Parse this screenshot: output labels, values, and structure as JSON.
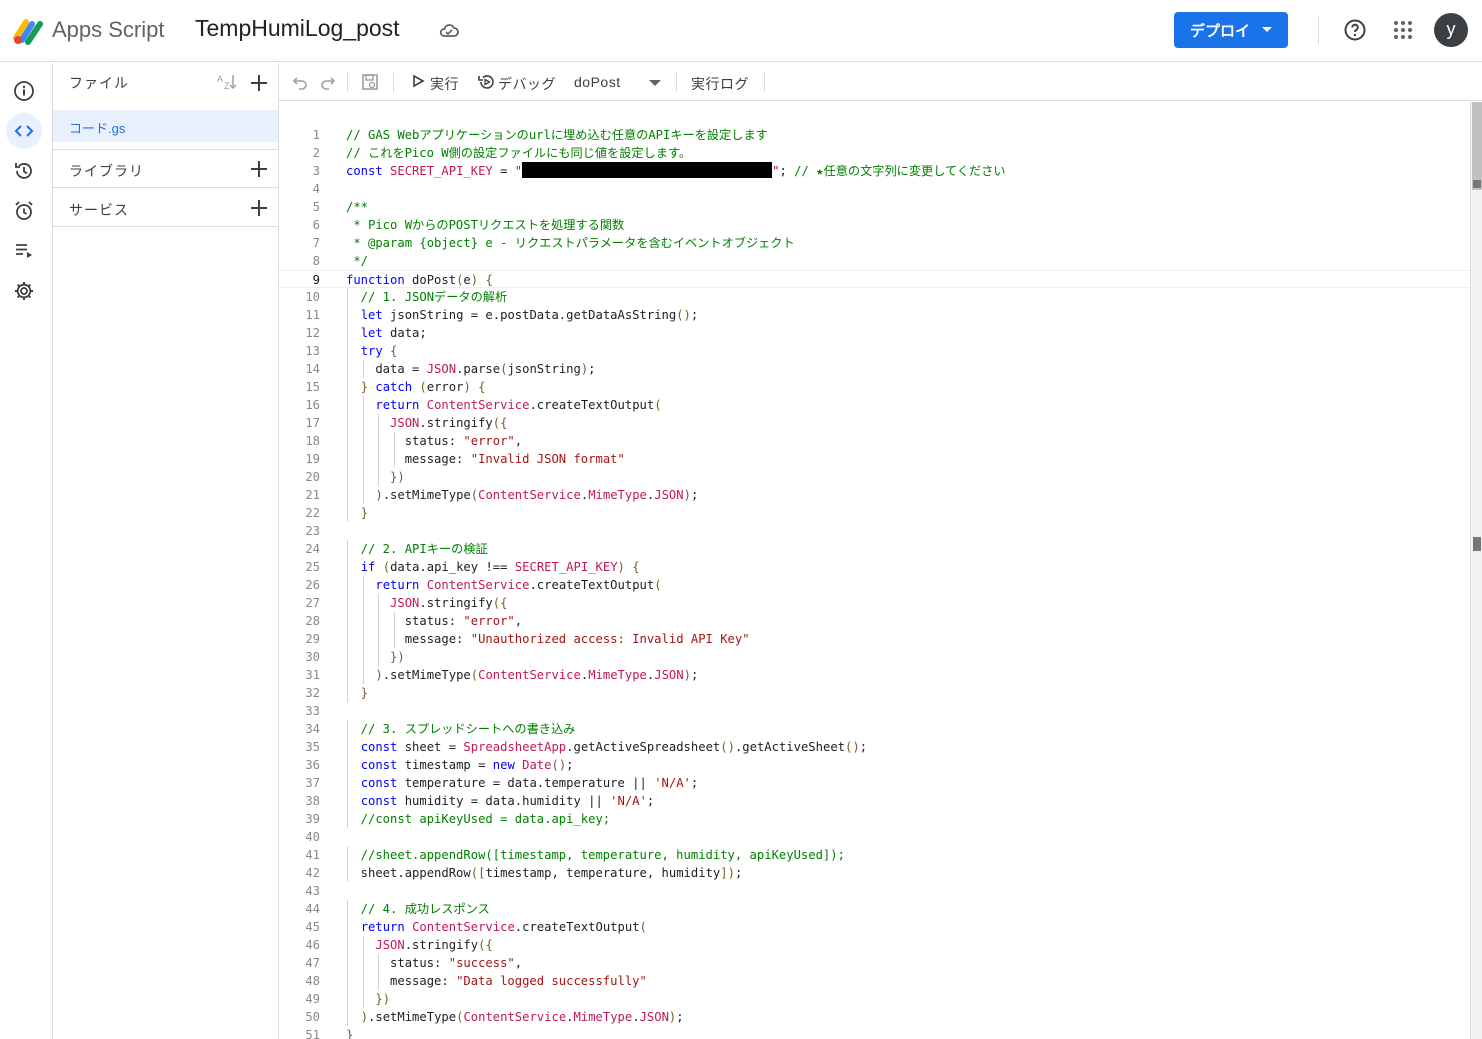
{
  "header": {
    "app_name": "Apps Script",
    "project_title": "TempHumiLog_post",
    "deploy_label": "デプロイ",
    "avatar_initial": "y",
    "accent_color": "#1a73e8"
  },
  "rail": {
    "items": [
      "info-icon",
      "code-icon",
      "history-icon",
      "alarm-icon",
      "executions-icon",
      "settings-icon"
    ],
    "active": "code-icon"
  },
  "files_panel": {
    "title": "ファイル",
    "files": [
      "コード.gs"
    ],
    "libraries_label": "ライブラリ",
    "services_label": "サービス"
  },
  "toolbar": {
    "run_label": "実行",
    "debug_label": "デバッグ",
    "function_name": "doPost",
    "log_label": "実行ログ"
  },
  "editor": {
    "current_line": 9,
    "line_numbers": [
      "1",
      "2",
      "3",
      "4",
      "5",
      "6",
      "7",
      "8",
      "9",
      "10",
      "11",
      "12",
      "13",
      "14",
      "15",
      "16",
      "17",
      "18",
      "19",
      "20",
      "21",
      "22",
      "23",
      "24",
      "25",
      "26",
      "27",
      "28",
      "29",
      "30",
      "31",
      "32",
      "33",
      "34",
      "35",
      "36",
      "37",
      "38",
      "39",
      "40",
      "41",
      "42",
      "43",
      "44",
      "45",
      "46",
      "47",
      "48",
      "49",
      "50",
      "51"
    ],
    "lines": [
      "// GAS Webアプリケーションのurlに埋め込む任意のAPIキーを設定します",
      "// これをPico W側の設定ファイルにも同じ値を設定します。",
      "const SECRET_API_KEY = \"[REDACTED]\"; // ★任意の文字列に変更してください",
      "",
      "/**",
      " * Pico WからのPOSTリクエストを処理する関数",
      " * @param {object} e - リクエストパラメータを含むイベントオブジェクト",
      " */",
      "function doPost(e) {",
      "  // 1. JSONデータの解析",
      "  let jsonString = e.postData.getDataAsString();",
      "  let data;",
      "  try {",
      "    data = JSON.parse(jsonString);",
      "  } catch (error) {",
      "    return ContentService.createTextOutput(",
      "      JSON.stringify({",
      "        status: \"error\",",
      "        message: \"Invalid JSON format\"",
      "      })",
      "    ).setMimeType(ContentService.MimeType.JSON);",
      "  }",
      "",
      "  // 2. APIキーの検証",
      "  if (data.api_key !== SECRET_API_KEY) {",
      "    return ContentService.createTextOutput(",
      "      JSON.stringify({",
      "        status: \"error\",",
      "        message: \"Unauthorized access: Invalid API Key\"",
      "      })",
      "    ).setMimeType(ContentService.MimeType.JSON);",
      "  }",
      "",
      "  // 3. スプレッドシートへの書き込み",
      "  const sheet = SpreadsheetApp.getActiveSpreadsheet().getActiveSheet();",
      "  const timestamp = new Date();",
      "  const temperature = data.temperature || 'N/A';",
      "  const humidity = data.humidity || 'N/A';",
      "  //const apiKeyUsed = data.api_key;",
      "",
      "  //sheet.appendRow([timestamp, temperature, humidity, apiKeyUsed]);",
      "  sheet.appendRow([timestamp, temperature, humidity]);",
      "",
      "  // 4. 成功レスポンス",
      "  return ContentService.createTextOutput(",
      "    JSON.stringify({",
      "      status: \"success\",",
      "      message: \"Data logged successfully\"",
      "    })",
      "  ).setMimeType(ContentService.MimeType.JSON);",
      "}"
    ]
  }
}
